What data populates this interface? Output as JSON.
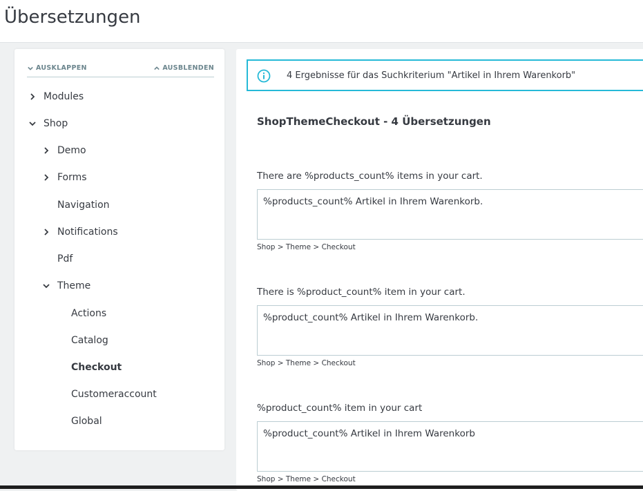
{
  "page": {
    "title": "Übersetzungen"
  },
  "tree": {
    "expand_label": "AUSKLAPPEN",
    "collapse_label": "AUSBLENDEN",
    "items": [
      {
        "label": "Modules",
        "chevron": "right"
      },
      {
        "label": "Shop",
        "chevron": "down"
      },
      {
        "label": "Demo",
        "chevron": "right"
      },
      {
        "label": "Forms",
        "chevron": "right"
      },
      {
        "label": "Navigation",
        "chevron": "none"
      },
      {
        "label": "Notifications",
        "chevron": "right"
      },
      {
        "label": "Pdf",
        "chevron": "none"
      },
      {
        "label": "Theme",
        "chevron": "down"
      },
      {
        "label": "Actions",
        "chevron": "none"
      },
      {
        "label": "Catalog",
        "chevron": "none"
      },
      {
        "label": "Checkout",
        "chevron": "none",
        "active": true
      },
      {
        "label": "Customeraccount",
        "chevron": "none"
      },
      {
        "label": "Global",
        "chevron": "none"
      }
    ]
  },
  "alert": {
    "message": "4 Ergebnisse für das Suchkriterium \"Artikel in Ihrem Warenkorb\"",
    "color": "#25b9d7",
    "icon": "info-icon"
  },
  "group": {
    "title": "ShopThemeCheckout - 4 Übersetzungen"
  },
  "translations": [
    {
      "source": "There are %products_count% items in your cart.",
      "value": "%products_count% Artikel in Ihrem Warenkorb.",
      "path": "Shop > Theme > Checkout"
    },
    {
      "source": "There is %product_count% item in your cart.",
      "value": "%product_count% Artikel in Ihrem Warenkorb.",
      "path": "Shop > Theme > Checkout"
    },
    {
      "source": "%product_count% item in your cart",
      "value": "%product_count% Artikel in Ihrem Warenkorb",
      "path": "Shop > Theme > Checkout"
    }
  ]
}
